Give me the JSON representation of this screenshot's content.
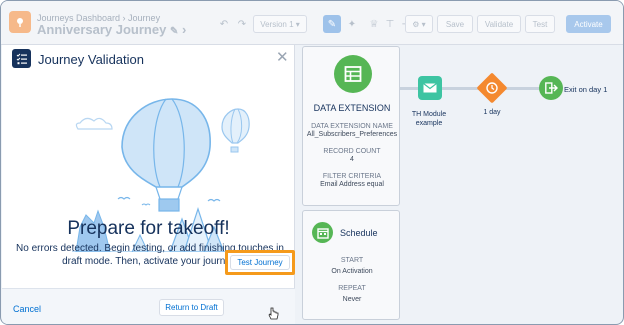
{
  "header": {
    "breadcrumb": "Journeys Dashboard › Journey",
    "title": "Anniversary Journey",
    "version": "Version 1",
    "save": "Save",
    "validate": "Validate",
    "test": "Test",
    "activate": "Activate"
  },
  "modal": {
    "title": "Journey Validation",
    "heading": "Prepare for takeoff!",
    "message": "No errors detected. Begin testing, or add finishing touches in draft mode. Then, activate your journey.",
    "cancel": "Cancel",
    "return_draft": "Return to Draft",
    "test_journey": "Test Journey"
  },
  "data_extension": {
    "title": "DATA EXTENSION",
    "name_label": "DATA EXTENSION NAME",
    "name_value": "All_Subscribers_Preferences",
    "count_label": "RECORD COUNT",
    "count_value": "4",
    "filter_label": "FILTER CRITERIA",
    "filter_value": "Email Address equal"
  },
  "schedule": {
    "title": "Schedule",
    "start_label": "START",
    "start_value": "On Activation",
    "repeat_label": "REPEAT",
    "repeat_value": "Never"
  },
  "flow": {
    "email_label": "TH Module example",
    "wait_label": "1 day",
    "exit_label": "Exit on day 1"
  },
  "colors": {
    "accent": "#0070d2",
    "navy": "#16325c",
    "green": "#56b655",
    "orange_highlight": "#f59a1b"
  }
}
